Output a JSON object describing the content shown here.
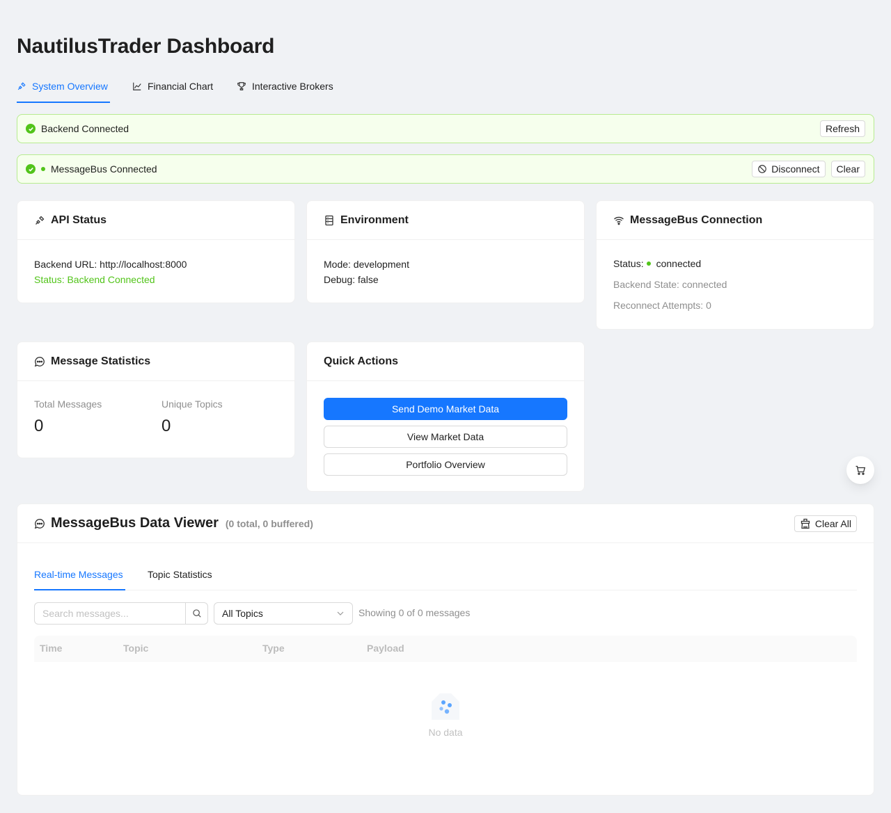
{
  "page": {
    "title": "NautilusTrader Dashboard"
  },
  "tabs": [
    {
      "label": "System Overview",
      "icon": "api-icon",
      "active": true
    },
    {
      "label": "Financial Chart",
      "icon": "line-chart-icon",
      "active": false
    },
    {
      "label": "Interactive Brokers",
      "icon": "trophy-icon",
      "active": false
    }
  ],
  "alerts": {
    "backend": {
      "text": "Backend Connected",
      "refresh_label": "Refresh"
    },
    "messagebus": {
      "text": "MessageBus Connected",
      "disconnect_label": "Disconnect",
      "clear_label": "Clear"
    }
  },
  "api_status": {
    "title": "API Status",
    "backend_url": "Backend URL: http://localhost:8000",
    "status": "Status: Backend Connected"
  },
  "environment": {
    "title": "Environment",
    "mode": "Mode: development",
    "debug": "Debug: false"
  },
  "mb_connection": {
    "title": "MessageBus Connection",
    "status_label": "Status:",
    "status_value": "connected",
    "backend_state": "Backend State: connected",
    "reconnect": "Reconnect Attempts: 0"
  },
  "message_stats": {
    "title": "Message Statistics",
    "total_label": "Total Messages",
    "total_value": "0",
    "unique_label": "Unique Topics",
    "unique_value": "0"
  },
  "quick_actions": {
    "title": "Quick Actions",
    "send_demo": "Send Demo Market Data",
    "view_market": "View Market Data",
    "portfolio": "Portfolio Overview"
  },
  "viewer": {
    "title": "MessageBus Data Viewer",
    "subtitle": "(0 total, 0 buffered)",
    "clear_all": "Clear All",
    "tabs": [
      "Real-time Messages",
      "Topic Statistics"
    ],
    "search_placeholder": "Search messages...",
    "topic_select": "All Topics",
    "showing": "Showing 0 of 0 messages",
    "columns": [
      "Time",
      "Topic",
      "Type",
      "Payload"
    ],
    "empty_text": "No data"
  },
  "colors": {
    "primary": "#1677ff",
    "success": "#52c41a",
    "alert_bg": "#f6ffed",
    "alert_border": "#b7eb8f"
  }
}
